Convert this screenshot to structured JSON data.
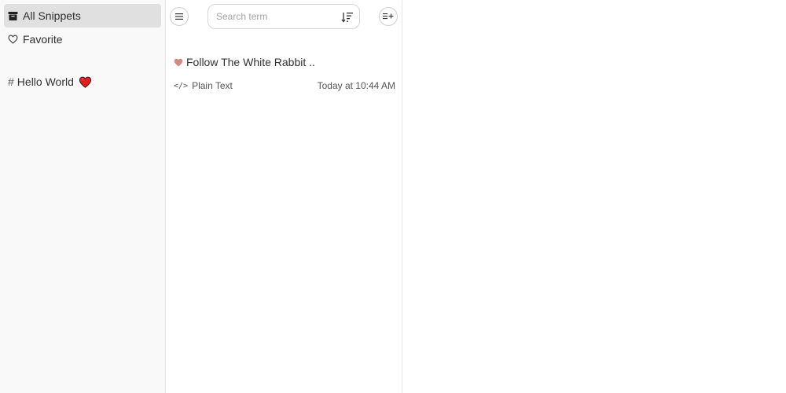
{
  "sidebar": {
    "items": [
      {
        "label": "All Snippets",
        "icon": "archive-box-icon",
        "active": true
      },
      {
        "label": "Favorite",
        "icon": "heart-outline-icon",
        "active": false
      }
    ],
    "tags": [
      {
        "label": "Hello World",
        "icon": "red-heart-emoji"
      }
    ]
  },
  "toolbar": {
    "menu_icon": "hamburger-menu-icon",
    "search_placeholder": "Search term",
    "sort_icon": "sort-descending-icon",
    "add_icon": "add-snippet-icon"
  },
  "snippets": [
    {
      "title": "Follow The White Rabbit ..",
      "favorite": true,
      "language": "Plain Text",
      "timestamp": "Today at 10:44 AM"
    }
  ],
  "colors": {
    "sidebar_bg": "#f9f9f9",
    "active_item_bg": "#e0e0e0",
    "favorite_heart": "#d08a80",
    "tag_heart": "#e02020"
  }
}
